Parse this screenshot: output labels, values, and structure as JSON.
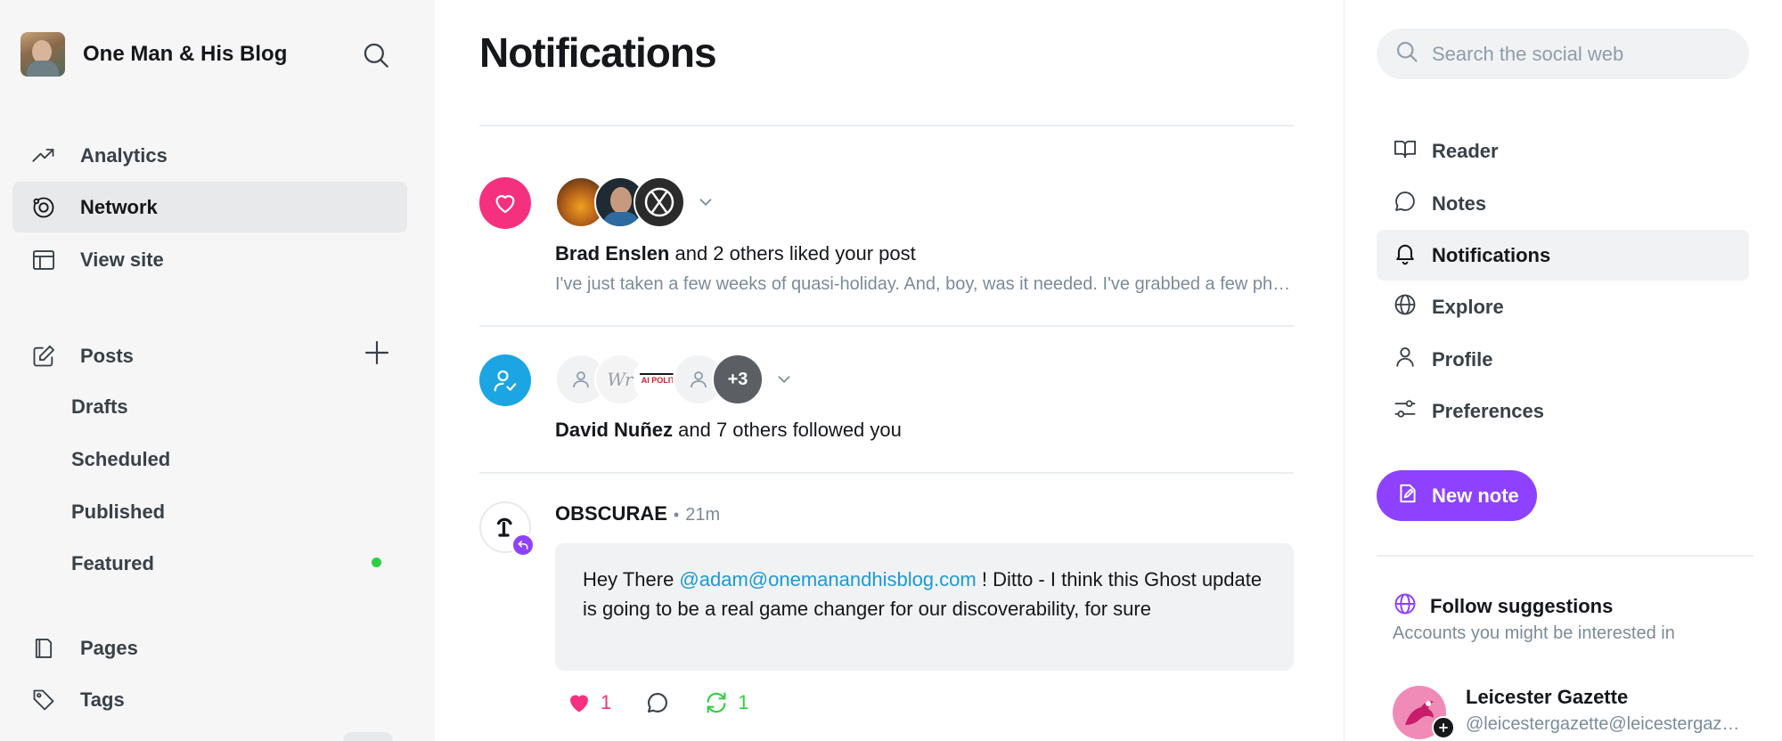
{
  "sidebar": {
    "site_name": "One Man & His Blog",
    "nav": {
      "analytics": "Analytics",
      "network": "Network",
      "view_site": "View site",
      "posts": "Posts",
      "pages": "Pages",
      "tags": "Tags"
    },
    "posts_sub": {
      "drafts": "Drafts",
      "scheduled": "Scheduled",
      "published": "Published",
      "featured": "Featured"
    }
  },
  "main": {
    "title": "Notifications",
    "likes": {
      "actor": "Brad Enslen",
      "rest": " and 2 others liked your post",
      "excerpt": "I've just taken a few weeks of quasi-holiday. And, boy, was it needed. I've grabbed a few photos and I'm going to share them here."
    },
    "follows": {
      "actor": "David Nuñez",
      "rest": " and 7 others followed you",
      "extra_count": "+3",
      "avatar_2_text": "Wr",
      "avatar_3_text": "AI POLITI"
    },
    "reply": {
      "author": "OBSCURAE",
      "separator": "•",
      "time": "21m",
      "text_before": "Hey There ",
      "mention": "@adam@onemanandhisblog.com",
      "text_after": " ! Ditto - I think this Ghost update is going to be a real game changer for our discoverability, for sure",
      "like_count": "1",
      "repost_count": "1"
    }
  },
  "right": {
    "search_placeholder": "Search the social web",
    "nav": {
      "reader": "Reader",
      "notes": "Notes",
      "notifications": "Notifications",
      "explore": "Explore",
      "profile": "Profile",
      "preferences": "Preferences"
    },
    "new_note": "New note",
    "follow_suggestions": {
      "title": "Follow suggestions",
      "subtitle": "Accounts you might be interested in",
      "first_name": "Leicester Gazette",
      "first_handle": "@leicestergazette@leicestergazette.social"
    }
  },
  "colors": {
    "like_pink": "#f5317f",
    "follow_blue": "#1ba5e2",
    "accent_purple": "#8e42ff",
    "mention_blue": "#1a9ad6",
    "featured_green": "#30cf43",
    "repost_green": "#30cf43"
  }
}
